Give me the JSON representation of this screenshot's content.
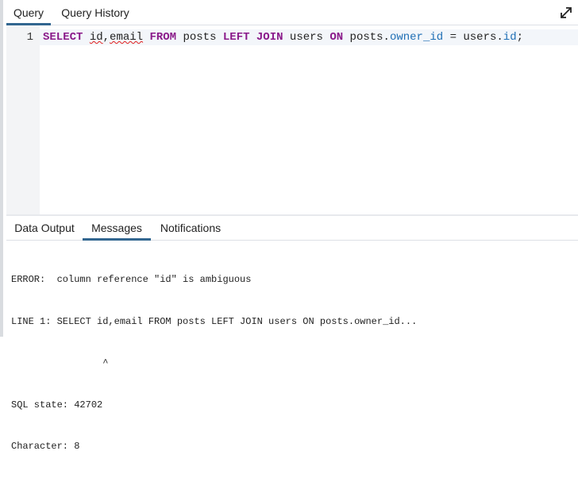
{
  "query_tabs": [
    "Query",
    "Query History"
  ],
  "expand_icon": "expand-icon",
  "editor": {
    "line_number": "1",
    "code_tokens": [
      {
        "text": "SELECT",
        "kind": "keyword"
      },
      {
        "text": " ",
        "kind": "plain"
      },
      {
        "text": "id",
        "kind": "error"
      },
      {
        "text": ",",
        "kind": "plain"
      },
      {
        "text": "email",
        "kind": "error"
      },
      {
        "text": " ",
        "kind": "plain"
      },
      {
        "text": "FROM",
        "kind": "keyword"
      },
      {
        "text": " posts ",
        "kind": "plain"
      },
      {
        "text": "LEFT",
        "kind": "keyword"
      },
      {
        "text": " ",
        "kind": "plain"
      },
      {
        "text": "JOIN",
        "kind": "keyword"
      },
      {
        "text": " users ",
        "kind": "plain"
      },
      {
        "text": "ON",
        "kind": "keyword"
      },
      {
        "text": " posts.",
        "kind": "plain"
      },
      {
        "text": "owner_id",
        "kind": "property"
      },
      {
        "text": " = users.",
        "kind": "plain"
      },
      {
        "text": "id",
        "kind": "property"
      },
      {
        "text": ";",
        "kind": "plain"
      }
    ]
  },
  "output_tabs": [
    "Data Output",
    "Messages",
    "Notifications"
  ],
  "messages": [
    "ERROR:  column reference \"id\" is ambiguous",
    "LINE 1: SELECT id,email FROM posts LEFT JOIN users ON posts.owner_id...",
    "                ^",
    "SQL state: 42702",
    "Character: 8"
  ],
  "colors": {
    "accent": "#326690",
    "keyword": "#8a1a8a",
    "property": "#1f6fb5",
    "error_underline": "#e02020"
  }
}
